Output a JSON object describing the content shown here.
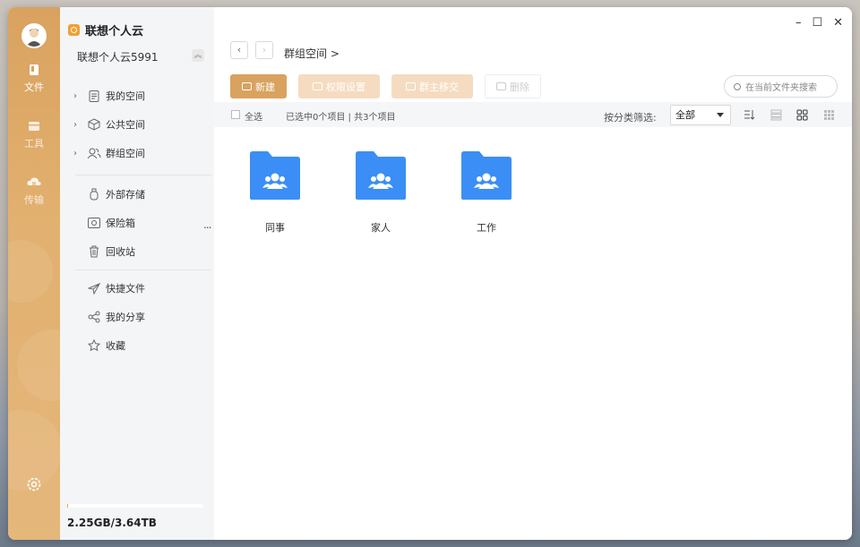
{
  "rail": {
    "items": [
      {
        "label": "文件",
        "icon": "file-icon"
      },
      {
        "label": "工具",
        "icon": "toolbox-icon"
      },
      {
        "label": "传输",
        "icon": "cloud-transfer-icon"
      }
    ],
    "settings_icon": "gear-icon"
  },
  "sidebar": {
    "brand": "联想个人云",
    "account": "联想个人云5991",
    "spaces": [
      {
        "label": "我的空间",
        "icon": "document-icon"
      },
      {
        "label": "公共空间",
        "icon": "box-icon"
      },
      {
        "label": "群组空间",
        "icon": "group-icon"
      }
    ],
    "storage_items": [
      {
        "label": "外部存储",
        "icon": "usb-icon"
      },
      {
        "label": "保险箱",
        "icon": "safe-icon"
      },
      {
        "label": "回收站",
        "icon": "trash-icon"
      }
    ],
    "quick_items": [
      {
        "label": "快捷文件",
        "icon": "send-icon"
      },
      {
        "label": "我的分享",
        "icon": "share-icon"
      },
      {
        "label": "收藏",
        "icon": "star-icon"
      }
    ],
    "more": "...",
    "storage": "2.25GB/3.64TB",
    "storage_used_fraction": 0.0006
  },
  "main": {
    "breadcrumb": "群组空间 >",
    "toolbar": {
      "new_label": "新建",
      "permission_label": "权限设置",
      "members_label": "群主移交",
      "delete_label": "删除"
    },
    "search_placeholder": "在当前文件夹搜索",
    "select_all": "全选",
    "selection_status": "已选中0个项目 | 共3个项目",
    "filter_label": "按分类筛选:",
    "filter_value": "全部",
    "folders": [
      {
        "name": "同事"
      },
      {
        "name": "家人"
      },
      {
        "name": "工作"
      }
    ]
  },
  "colors": {
    "accent": "#d9a25f",
    "folder": "#3a8ef6"
  }
}
